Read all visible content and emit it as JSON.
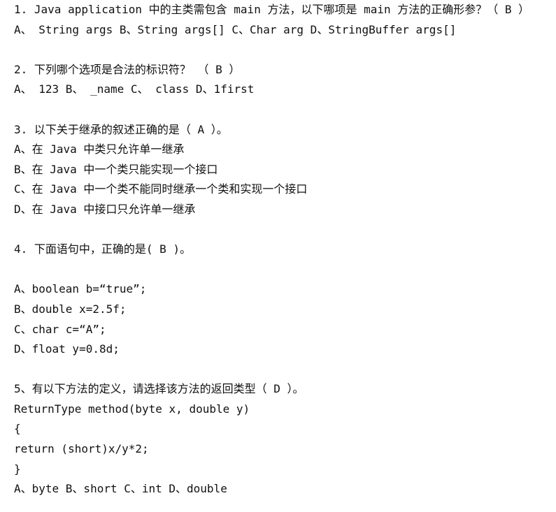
{
  "questions": [
    {
      "lines": [
        "1. Java application 中的主类需包含 main 方法，以下哪项是 main 方法的正确形参？（ B ）",
        "A、 String args B、String args[] C、Char arg D、StringBuffer args[]"
      ]
    },
    {
      "lines": [
        "2. 下列哪个选项是合法的标识符？ （ B ）",
        "A、 123 B、 _name C、 class D、1first"
      ]
    },
    {
      "lines": [
        "3. 以下关于继承的叙述正确的是（ A ）。",
        "A、在 Java 中类只允许单一继承",
        "B、在 Java 中一个类只能实现一个接口",
        "C、在 Java 中一个类不能同时继承一个类和实现一个接口",
        "D、在 Java 中接口只允许单一继承"
      ]
    },
    {
      "lines": [
        "4. 下面语句中，正确的是( B )。",
        "",
        "A、boolean b=“true”;",
        "B、double x=2.5f;",
        "C、char c=“A”;",
        "D、float y=0.8d;"
      ]
    },
    {
      "lines": [
        "5、有以下方法的定义，请选择该方法的返回类型（ D ）。",
        "ReturnType method(byte x, double y)",
        "{",
        "return (short)x/y*2;",
        "}",
        "A、byte B、short C、int D、double"
      ]
    }
  ]
}
